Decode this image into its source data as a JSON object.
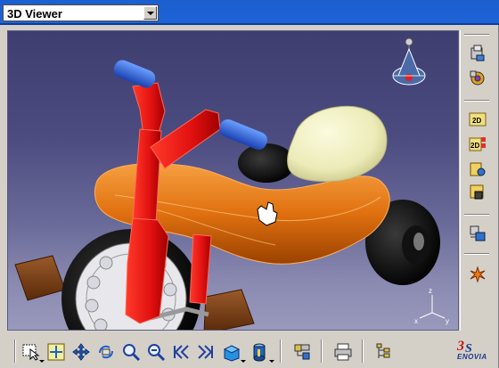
{
  "window": {
    "viewer_title": "3D Viewer"
  },
  "viewport": {
    "compass_axis_label": "z",
    "triad_labels": {
      "x": "x",
      "y": "y",
      "z": "z"
    },
    "model": "tricycle"
  },
  "right_toolbar": {
    "buttons": [
      {
        "icon": "insert-component-icon"
      },
      {
        "icon": "product-gear-icon"
      },
      {
        "icon": "2d-view-icon",
        "label": "2D"
      },
      {
        "icon": "2d-layout-icon",
        "label": "2D"
      },
      {
        "icon": "load-document-icon"
      },
      {
        "icon": "save-document-icon"
      },
      {
        "icon": "mass-properties-icon"
      },
      {
        "icon": "explode-icon"
      }
    ]
  },
  "bottom_toolbar": {
    "buttons": [
      {
        "icon": "select-icon"
      },
      {
        "icon": "fit-all-icon"
      },
      {
        "icon": "pan-icon"
      },
      {
        "icon": "rotate-icon"
      },
      {
        "icon": "zoom-in-icon"
      },
      {
        "icon": "zoom-out-icon"
      },
      {
        "icon": "previous-view-icon"
      },
      {
        "icon": "next-view-icon"
      },
      {
        "icon": "isometric-view-icon"
      },
      {
        "icon": "shading-icon"
      },
      {
        "icon": "product-structure-icon"
      },
      {
        "icon": "print-icon"
      },
      {
        "icon": "tree-icon"
      }
    ]
  },
  "brand": {
    "logo_text": "ENOVIA",
    "logo_mark": "3DS"
  },
  "colors": {
    "titlebar": "#1e63d6",
    "background_top": "#3e3e70",
    "background_bottom": "#9999bd",
    "body_orange": "#e07010",
    "frame_red": "#e01010",
    "handle_blue": "#2a60d8",
    "seat_cream": "#ecebb8"
  }
}
